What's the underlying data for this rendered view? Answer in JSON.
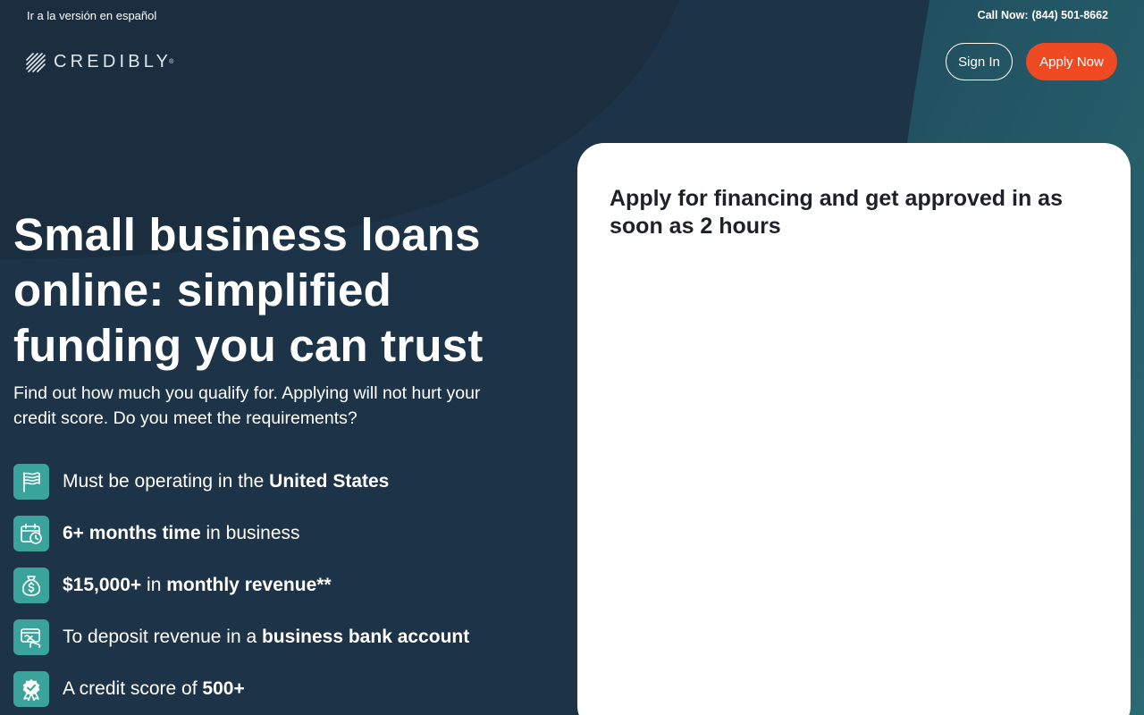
{
  "topbar": {
    "language_link": "Ir a la versión en español",
    "call_label": "Call Now:",
    "phone": "(844) 501-8662"
  },
  "header": {
    "logo_text": "CREDIBLY",
    "logo_mark": "®",
    "sign_in_label": "Sign In",
    "apply_label": "Apply Now"
  },
  "hero": {
    "title": "Small business loans online: simplified funding you can trust",
    "subtitle": "Find out how much you qualify for.  Applying will not hurt your credit score.  Do you meet the requirements?"
  },
  "requirements": [
    {
      "icon": "flag-icon",
      "pre": "Must be operating in the ",
      "bold1": "United States",
      "mid": "",
      "bold2": "",
      "post": ""
    },
    {
      "icon": "calendar-clock-icon",
      "pre": "",
      "bold1": "6+ months time",
      "mid": "",
      "bold2": "",
      "post": " in business"
    },
    {
      "icon": "money-bag-icon",
      "pre": "",
      "bold1": "$15,000+",
      "mid": " in ",
      "bold2": "monthly revenue**",
      "post": ""
    },
    {
      "icon": "bank-account-icon",
      "pre": "To deposit revenue in a ",
      "bold1": "business bank account",
      "mid": "",
      "bold2": "",
      "post": ""
    },
    {
      "icon": "award-badge-icon",
      "pre": "A credit score of ",
      "bold1": "500+",
      "mid": "",
      "bold2": "",
      "post": ""
    }
  ],
  "form": {
    "title": "Apply for financing and get approved in as soon as 2 hours"
  },
  "colors": {
    "background": "#1d3347",
    "accent_teal": "#3aa39b",
    "apply_button": "#f04a23",
    "card": "#ffffff"
  }
}
